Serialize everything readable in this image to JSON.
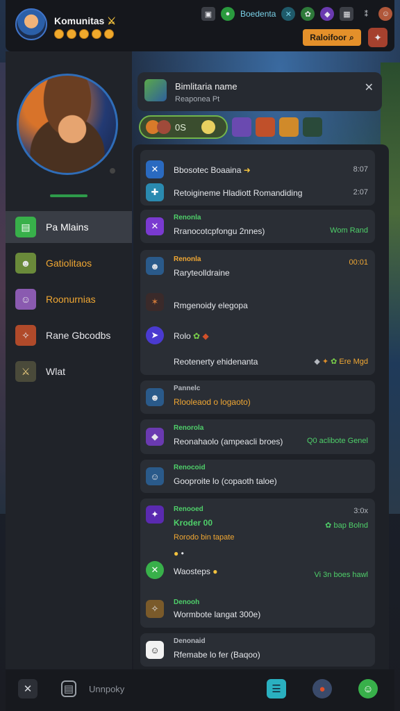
{
  "header": {
    "title": "Komunitas",
    "title_badge": "⚔",
    "coins": [
      "coin",
      "coin",
      "coin",
      "coin",
      "coin"
    ],
    "status_label": "Boedenta",
    "button_label": "Raloifoor",
    "icons": [
      "shop-icon",
      "circle-badge-icon",
      "target-icon",
      "leaf-icon",
      "crystal-icon",
      "bell-icon",
      "user-avatar-icon"
    ]
  },
  "sidebar": {
    "items": [
      {
        "label": "Pa Mlains",
        "icon": "chat-icon",
        "color": "#ffffff"
      },
      {
        "label": "Gatiolitaos",
        "icon": "hero-icon",
        "color": "#f0a733"
      },
      {
        "label": "Roonurnias",
        "icon": "hero2-icon",
        "color": "#f0a733"
      },
      {
        "label": "Rane Gbcodbs",
        "icon": "champion-icon",
        "color": "#e6e6ea"
      },
      {
        "label": "Wlat",
        "icon": "sword-icon",
        "color": "#e6e6ea"
      }
    ]
  },
  "notification": {
    "title": "Bimlitaria name",
    "subtitle": "Reaponea Pt"
  },
  "filter": {
    "pill_label": "0S"
  },
  "feed": {
    "card1": {
      "row1_text": "Bbosotec Boaaina",
      "row1_time": "8:07",
      "row2_text": "Retoigineme Hladiott Romandiding",
      "row2_time": "2:07"
    },
    "card2": {
      "label": "Renonla",
      "text": "Rranocotcpfongu 2nnes)",
      "right": "Wom Rand"
    },
    "card3": {
      "label": "Renonla",
      "row1_text": "Raryteolldraine",
      "time": "00:01",
      "row2_text": "Rmgenoidy elegopa",
      "row3_text": "Rolo",
      "row4_text": "Reotenerty ehidenanta",
      "row4_right": "Ere Mgd"
    },
    "card4": {
      "label": "Pannelc",
      "text": "Rlooleaod o logaoto)"
    },
    "card5": {
      "label": "Renorola",
      "text": "Reonahaolo (ampeacli broes)",
      "right": "Q0 aclibote Genel"
    },
    "card6": {
      "label": "Renocoid",
      "text": "Gooproite lo (copaoth taloe)"
    },
    "card7": {
      "label": "Renooed",
      "title": "Kroder 00",
      "time": "3:0x",
      "subtitle": "Rorodo bin tapate",
      "right1": "bap Bolnd",
      "row3_text": "Waosteps",
      "right2": "Vi 3n boes hawl",
      "row4_label": "Denooh",
      "row4_text": "Wormbote langat 300e)"
    },
    "card8": {
      "label": "Denonaid",
      "text": "Rfemabe lo fer (Baqoo)"
    }
  },
  "bottom": {
    "label": "Unnpoky"
  }
}
